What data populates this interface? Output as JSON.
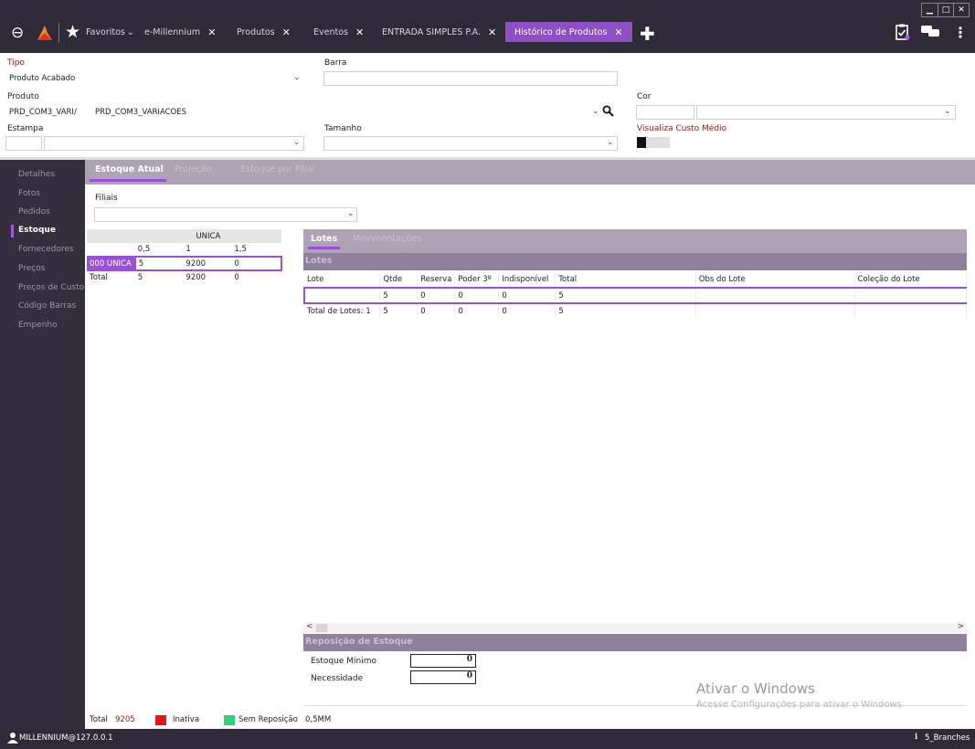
{
  "window": {
    "minimize": "▁",
    "maximize": "□",
    "close": "✕"
  },
  "tabs": {
    "favoritos": "Favoritos",
    "items": [
      {
        "label": "e-Millennium"
      },
      {
        "label": "Produtos"
      },
      {
        "label": "Eventos"
      },
      {
        "label": "ENTRADA SIMPLES P.A."
      },
      {
        "label": "Histórico de Produtos"
      }
    ]
  },
  "form": {
    "tipo_label": "Tipo",
    "tipo_value": "Produto Acabado",
    "barra_label": "Barra",
    "barra_value": "",
    "produto_label": "Produto",
    "produto_code": "PRD_COM3_VARI/",
    "produto_name": "PRD_COM3_VARIACOES",
    "cor_label": "Cor",
    "estampa_label": "Estampa",
    "tamanho_label": "Tamanho",
    "custo_label": "Visualiza Custo Médio"
  },
  "sidebar": {
    "items": [
      {
        "label": "Detalhes"
      },
      {
        "label": "Fotos"
      },
      {
        "label": "Pedidos"
      },
      {
        "label": "Estoque"
      },
      {
        "label": "Fornecedores"
      },
      {
        "label": "Preços"
      },
      {
        "label": "Preços de Custo"
      },
      {
        "label": "Código Barras"
      },
      {
        "label": "Empenho"
      }
    ]
  },
  "subtabs": {
    "estoque_atual": "Estoque Atual",
    "projecao": "Projeção",
    "por_filial": "Estoque por Filial"
  },
  "filiais": {
    "label": "Filiais",
    "value": ""
  },
  "grid": {
    "group": "UNICA",
    "sizes": [
      "0,5",
      "1",
      "1,5"
    ],
    "rows": [
      {
        "label": "000 UNICA",
        "values": [
          "5",
          "9200",
          "0"
        ]
      },
      {
        "label": "Total",
        "values": [
          "5",
          "9200",
          "0"
        ]
      }
    ]
  },
  "right_tabs": {
    "lotes": "Lotes",
    "movimentacoes": "Movimentações"
  },
  "lotes": {
    "header": "Lotes",
    "columns": [
      "Lote",
      "Qtde",
      "Reserva",
      "Poder 3º",
      "Indisponível",
      "Total",
      "Obs do Lote",
      "Coleção do Lote"
    ],
    "row": [
      "",
      "5",
      "0",
      "0",
      "0",
      "5",
      "",
      ""
    ],
    "total_row": [
      "Total de Lotes: 1",
      "5",
      "0",
      "0",
      "0",
      "5",
      "",
      ""
    ]
  },
  "reposicao": {
    "header": "Reposição de Estoque",
    "minimo_label": "Estoque Mínimo",
    "minimo_value": "0",
    "necessidade_label": "Necessidade",
    "necessidade_value": "0"
  },
  "legend": {
    "total_label": "Total",
    "total_value": "9205",
    "inativa": "Inativa",
    "sem_reposicao": "Sem Reposição",
    "code": "0,5MM",
    "inativa_color": "#e8141b",
    "sem_reposicao_color": "#2ed574"
  },
  "status": {
    "user": "MILLENNIUM@127.0.0.1",
    "branch": "5_Branches"
  },
  "watermark": {
    "title": "Ativar o Windows",
    "subtitle": "Acesse Configurações para ativar o Windows."
  },
  "colors": {
    "accent": "#9a4fd6",
    "topbar": "#2f2a37",
    "sidebar": "#352f3d"
  }
}
